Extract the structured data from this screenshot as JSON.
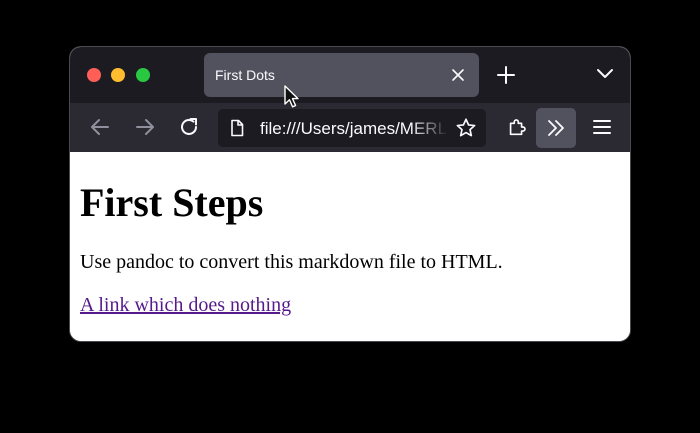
{
  "browser": {
    "tab": {
      "title": "First Dots",
      "close_icon": "close-icon"
    },
    "new_tab_icon": "plus-icon",
    "tab_list_icon": "chevron-down-icon",
    "nav": {
      "back_icon": "arrow-left-icon",
      "forward_icon": "arrow-right-icon",
      "reload_icon": "reload-icon"
    },
    "url": "file:///Users/james/MERL",
    "page_icon": "document-icon",
    "bookmark_icon": "star-icon",
    "extensions_icon": "puzzle-icon",
    "overflow_icon": "double-chevron-right-icon",
    "menu_icon": "hamburger-menu-icon"
  },
  "page": {
    "heading": "First Steps",
    "paragraph": "Use pandoc to convert this markdown file to HTML.",
    "link_text": "A link which does nothing"
  },
  "colors": {
    "tabstrip_bg": "#1c1b22",
    "active_tab_bg": "#52525e",
    "toolbar_bg": "#2b2a33",
    "visited_link": "#551a8b"
  }
}
